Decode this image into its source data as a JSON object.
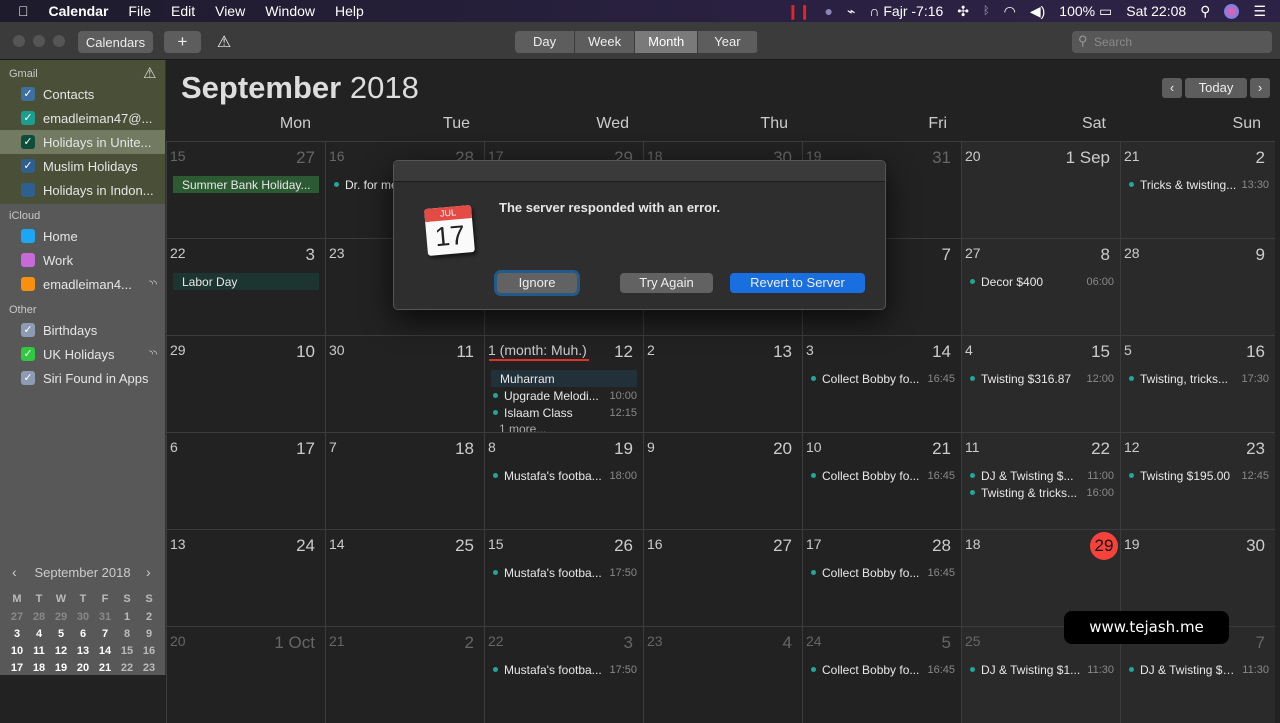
{
  "menubar": {
    "apple": "",
    "app": "Calendar",
    "items": [
      "File",
      "Edit",
      "View",
      "Window",
      "Help"
    ],
    "prayer": "Fajr -7:16",
    "battery": "100%",
    "clock": "Sat 22:08"
  },
  "toolbar": {
    "calendars": "Calendars",
    "add": "+",
    "warning": "⚠",
    "views": [
      "Day",
      "Week",
      "Month",
      "Year"
    ],
    "active_view": "Month",
    "search_placeholder": "Search"
  },
  "sidebar": {
    "sections": [
      {
        "title": "Gmail",
        "items": [
          {
            "label": "Contacts",
            "color": "#3d6fa0",
            "checked": true
          },
          {
            "label": "emadleiman47@...",
            "color": "#1b9e8e",
            "checked": true
          },
          {
            "label": "Holidays in Unite...",
            "color": "#0d4d3a",
            "checked": true,
            "selected": true
          },
          {
            "label": "Muslim Holidays",
            "color": "#2f5f8f",
            "checked": true
          },
          {
            "label": "Holidays in Indon...",
            "color": "#2f5f8f",
            "checked": false
          }
        ]
      },
      {
        "title": "iCloud",
        "items": [
          {
            "label": "Home",
            "color": "#1ba7f5",
            "checked": false
          },
          {
            "label": "Work",
            "color": "#c66ad8",
            "checked": false
          },
          {
            "label": "emadleiman4...",
            "color": "#f7900d",
            "checked": false,
            "shared": true
          }
        ]
      },
      {
        "title": "Other",
        "items": [
          {
            "label": "Birthdays",
            "color": "#8d9cb4",
            "checked": true
          },
          {
            "label": "UK Holidays",
            "color": "#2fc840",
            "checked": true,
            "shared": true
          },
          {
            "label": "Siri Found in Apps",
            "color": "#8d9cb4",
            "checked": true
          }
        ]
      }
    ],
    "mini": {
      "title": "September 2018",
      "weekdays": [
        "M",
        "T",
        "W",
        "T",
        "F",
        "S",
        "S"
      ],
      "rows": [
        [
          "27",
          "28",
          "29",
          "30",
          "31",
          "1",
          "2"
        ],
        [
          "3",
          "4",
          "5",
          "6",
          "7",
          "8",
          "9"
        ],
        [
          "10",
          "11",
          "12",
          "13",
          "14",
          "15",
          "16"
        ],
        [
          "17",
          "18",
          "19",
          "20",
          "21",
          "22",
          "23"
        ]
      ],
      "dim_first_row": 5
    }
  },
  "main": {
    "month": "September",
    "year": "2018",
    "today_btn": "Today",
    "prev": "‹",
    "next": "›",
    "weekdays": [
      "Mon",
      "Tue",
      "Wed",
      "Thu",
      "Fri",
      "Sat",
      "Sun"
    ],
    "weeks": [
      [
        {
          "h": "15",
          "g": "27",
          "dim": true,
          "events": [
            {
              "title": "Summer Bank Holiday...",
              "bar": "#2c5a32"
            }
          ]
        },
        {
          "h": "16",
          "g": "28",
          "dim": true,
          "events": [
            {
              "title": "Dr. for me"
            }
          ]
        },
        {
          "h": "17",
          "g": "29",
          "dim": true
        },
        {
          "h": "18",
          "g": "30",
          "dim": true
        },
        {
          "h": "19",
          "g": "31",
          "dim": true
        },
        {
          "h": "20",
          "g": "1 Sep"
        },
        {
          "h": "21",
          "g": "2",
          "events": [
            {
              "title": "Tricks & twisting...",
              "time": "13:30"
            }
          ]
        }
      ],
      [
        {
          "h": "22",
          "g": "3",
          "events": [
            {
              "title": "Labor Day",
              "bar": "#1d3530"
            }
          ]
        },
        {
          "h": "23",
          "g": ""
        },
        {
          "h": "",
          "g": ""
        },
        {
          "h": "",
          "g": ""
        },
        {
          "h": "",
          "g": "7"
        },
        {
          "h": "27",
          "g": "8",
          "events": [
            {
              "title": "Decor $400",
              "time": "06:00"
            }
          ]
        },
        {
          "h": "28",
          "g": "9"
        }
      ],
      [
        {
          "h": "29",
          "g": "10"
        },
        {
          "h": "30",
          "g": "11"
        },
        {
          "h": "1 (month: Muh.)",
          "g": "12",
          "underline": true,
          "events": [
            {
              "title": "Muharram",
              "bar": "#22303a"
            },
            {
              "title": "Upgrade Melodi...",
              "time": "10:00"
            },
            {
              "title": "Islaam Class",
              "time": "12:15"
            }
          ],
          "more": "1 more..."
        },
        {
          "h": "2",
          "g": "13"
        },
        {
          "h": "3",
          "g": "14",
          "events": [
            {
              "title": "Collect Bobby fo...",
              "time": "16:45"
            }
          ]
        },
        {
          "h": "4",
          "g": "15",
          "events": [
            {
              "title": "Twisting $316.87",
              "time": "12:00"
            }
          ]
        },
        {
          "h": "5",
          "g": "16",
          "events": [
            {
              "title": "Twisting, tricks...",
              "time": "17:30"
            }
          ]
        }
      ],
      [
        {
          "h": "6",
          "g": "17"
        },
        {
          "h": "7",
          "g": "18"
        },
        {
          "h": "8",
          "g": "19",
          "events": [
            {
              "title": "Mustafa's footba...",
              "time": "18:00"
            }
          ]
        },
        {
          "h": "9",
          "g": "20"
        },
        {
          "h": "10",
          "g": "21",
          "events": [
            {
              "title": "Collect Bobby fo...",
              "time": "16:45"
            }
          ]
        },
        {
          "h": "11",
          "g": "22",
          "events": [
            {
              "title": "DJ & Twisting $...",
              "time": "11:00"
            },
            {
              "title": "Twisting & tricks...",
              "time": "16:00"
            }
          ]
        },
        {
          "h": "12",
          "g": "23",
          "events": [
            {
              "title": "Twisting $195.00",
              "time": "12:45"
            }
          ]
        }
      ],
      [
        {
          "h": "13",
          "g": "24"
        },
        {
          "h": "14",
          "g": "25"
        },
        {
          "h": "15",
          "g": "26",
          "events": [
            {
              "title": "Mustafa's footba...",
              "time": "17:50"
            }
          ]
        },
        {
          "h": "16",
          "g": "27"
        },
        {
          "h": "17",
          "g": "28",
          "events": [
            {
              "title": "Collect Bobby fo...",
              "time": "16:45"
            }
          ]
        },
        {
          "h": "18",
          "g": "29",
          "today": true
        },
        {
          "h": "19",
          "g": "30"
        }
      ],
      [
        {
          "h": "20",
          "g": "1 Oct",
          "dim": true
        },
        {
          "h": "21",
          "g": "2",
          "dim": true
        },
        {
          "h": "22",
          "g": "3",
          "dim": true,
          "events": [
            {
              "title": "Mustafa's footba...",
              "time": "17:50"
            }
          ]
        },
        {
          "h": "23",
          "g": "4",
          "dim": true
        },
        {
          "h": "24",
          "g": "5",
          "dim": true,
          "events": [
            {
              "title": "Collect Bobby fo...",
              "time": "16:45"
            }
          ]
        },
        {
          "h": "25",
          "g": "",
          "dim": true,
          "events": [
            {
              "title": "DJ & Twisting $1...",
              "time": "11:30"
            }
          ]
        },
        {
          "h": "",
          "g": "7",
          "dim": true,
          "events": [
            {
              "title": "DJ & Twisting $1...",
              "time": "11:30"
            }
          ]
        }
      ]
    ]
  },
  "dialog": {
    "message": "The server responded with an error.",
    "icon_month": "JUL",
    "icon_day": "17",
    "buttons": {
      "ignore": "Ignore",
      "try_again": "Try Again",
      "revert": "Revert to Server"
    },
    "accent": "#1a6fe0"
  },
  "watermark": "www.tejash.me"
}
